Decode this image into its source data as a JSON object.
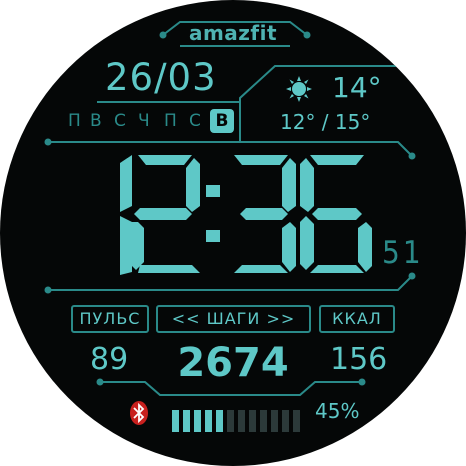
{
  "brand": "amazfit",
  "date": "26/03",
  "weekdays": [
    "П",
    "В",
    "С",
    "Ч",
    "П",
    "С",
    "В"
  ],
  "active_weekday_index": 6,
  "weather": {
    "icon": "sun-icon",
    "temp": "14°",
    "range": "12° / 15°"
  },
  "time": {
    "hours": "12",
    "minutes": "36",
    "seconds": "51"
  },
  "stats": {
    "pulse_label": "ПУЛЬС",
    "steps_label": "<< ШАГИ >>",
    "kcal_label": "ККАЛ",
    "pulse_value": "89",
    "steps_value": "2674",
    "kcal_value": "156"
  },
  "battery": {
    "percent_text": "45%",
    "level": 0.45,
    "segments_total": 12,
    "segments_filled": 5
  },
  "bluetooth": {
    "icon": "bluetooth-icon",
    "connected": false
  },
  "colors": {
    "accent": "#5ec8c7",
    "line": "#2a8a89",
    "dim_segment": "#2c3a3a",
    "alert": "#c8201e",
    "background": "#050707"
  }
}
